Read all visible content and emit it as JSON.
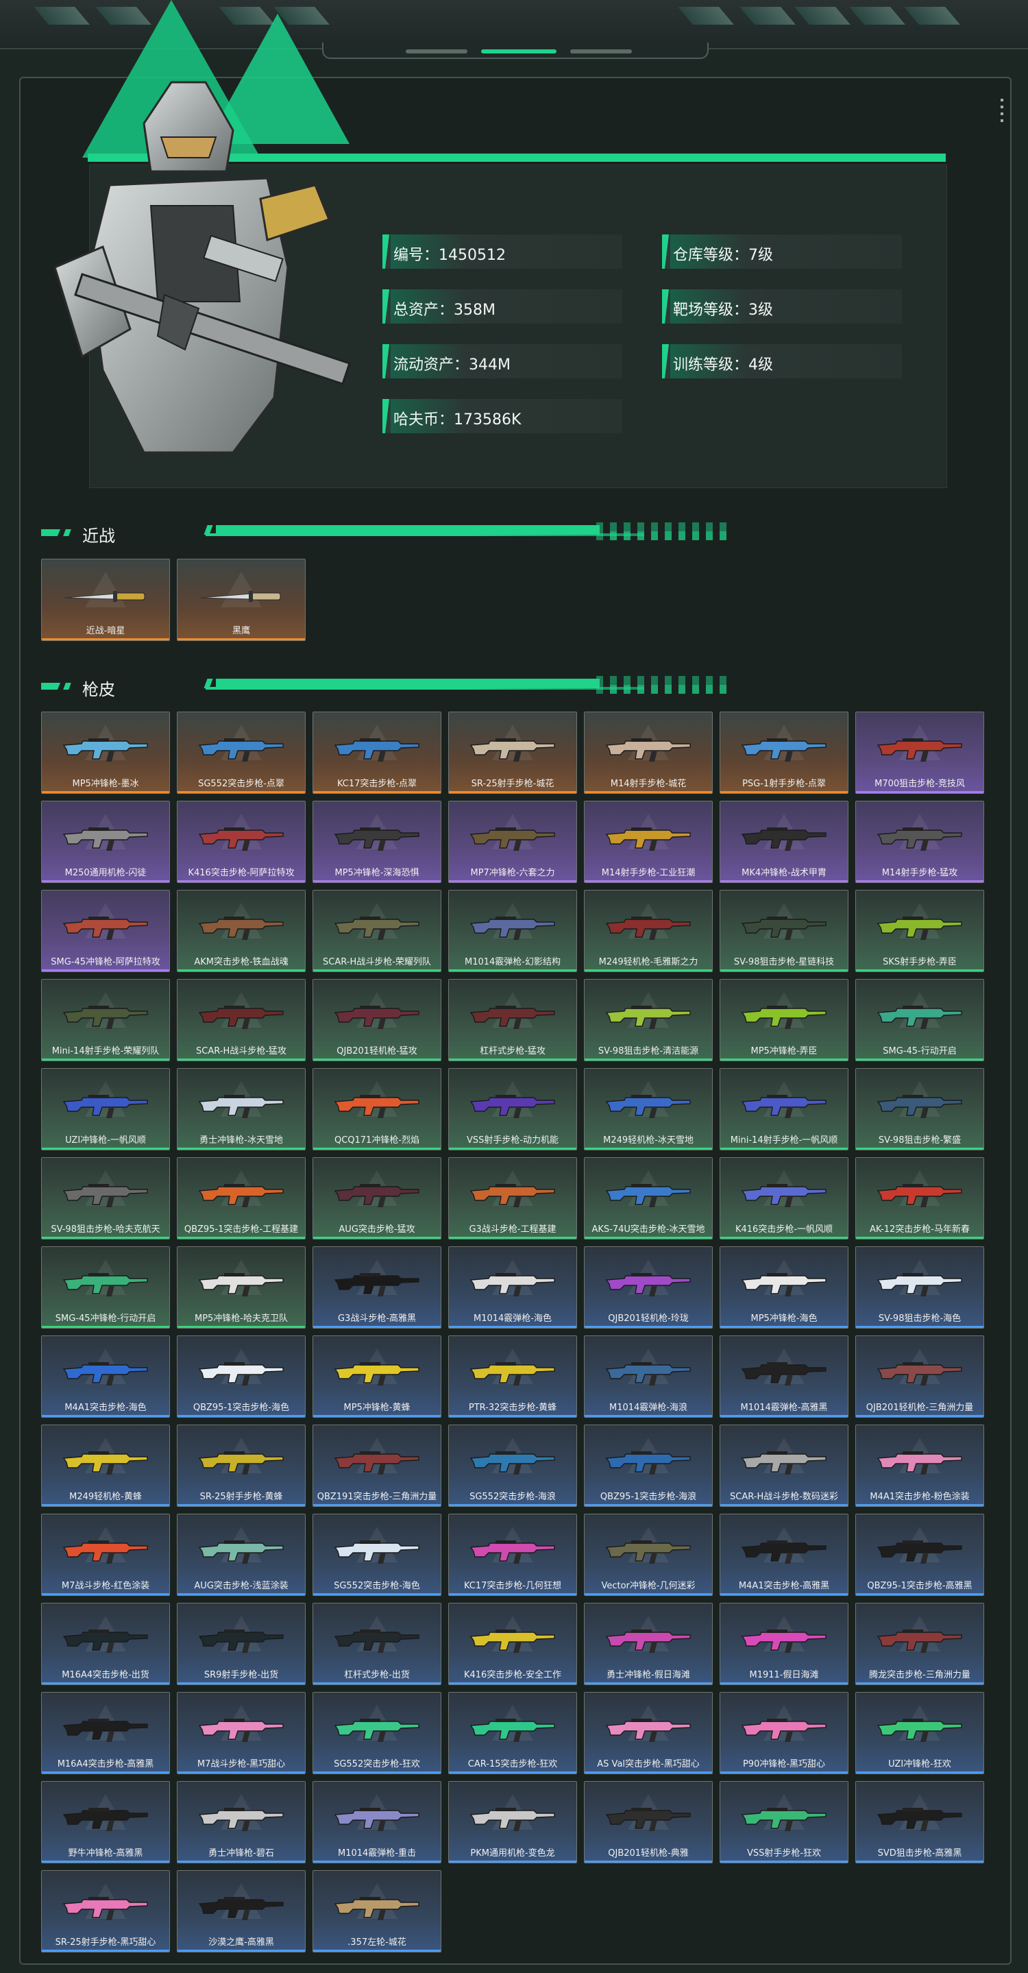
{
  "profile": {
    "stats_left": [
      "编号：1450512",
      "总资产：358M",
      "流动资产：344M",
      "哈夫币：173586K"
    ],
    "stats_right": [
      "仓库等级：7级",
      "靶场等级：3级",
      "训练等级：4级"
    ]
  },
  "sections": {
    "melee_title": "近战",
    "skins_title": "枪皮"
  },
  "melee": [
    {
      "label": "近战-暗星",
      "rarity": "orange",
      "color": "#c9a53a"
    },
    {
      "label": "黑鹰",
      "rarity": "orange",
      "color": "#c8b690"
    }
  ],
  "skins": [
    {
      "label": "MP5冲锋枪-墨冰",
      "rarity": "orange",
      "color": "#5fb0d8"
    },
    {
      "label": "SG552突击步枪-点翠",
      "rarity": "orange",
      "color": "#3f86c9"
    },
    {
      "label": "KC17突击步枪-点翠",
      "rarity": "orange",
      "color": "#3b7fc4"
    },
    {
      "label": "SR-25射手步枪-城花",
      "rarity": "orange",
      "color": "#c8b8a0"
    },
    {
      "label": "M14射手步枪-城花",
      "rarity": "orange",
      "color": "#c9b09a"
    },
    {
      "label": "PSG-1射手步枪-点翠",
      "rarity": "orange",
      "color": "#4a8fd0"
    },
    {
      "label": "M700狙击步枪-竞技风",
      "rarity": "purple",
      "color": "#b03a2e"
    },
    {
      "label": "M250通用机枪-闪徒",
      "rarity": "purple",
      "color": "#8c8c8c"
    },
    {
      "label": "K416突击步枪-阿萨拉特攻",
      "rarity": "purple",
      "color": "#a53a3a"
    },
    {
      "label": "MP5冲锋枪-深海恐惧",
      "rarity": "purple",
      "color": "#3a3a3a"
    },
    {
      "label": "MP7冲锋枪-六套之力",
      "rarity": "purple",
      "color": "#6a5a3a"
    },
    {
      "label": "M14射手步枪-工业狂潮",
      "rarity": "purple",
      "color": "#c9982a"
    },
    {
      "label": "MK4冲锋枪-战术甲胄",
      "rarity": "purple",
      "color": "#2e2e2e"
    },
    {
      "label": "M14射手步枪-猛攻",
      "rarity": "purple",
      "color": "#555555"
    },
    {
      "label": "SMG-45冲锋枪-阿萨拉特攻",
      "rarity": "purple",
      "color": "#b04a3a"
    },
    {
      "label": "AKM突击步枪-铁血战魂",
      "rarity": "green",
      "color": "#8a5a3a"
    },
    {
      "label": "SCAR-H战斗步枪-荣耀列队",
      "rarity": "green",
      "color": "#6b6b4a"
    },
    {
      "label": "M1014霰弹枪-幻影结构",
      "rarity": "green",
      "color": "#5a6aa0"
    },
    {
      "label": "M249轻机枪-毛雅斯之力",
      "rarity": "green",
      "color": "#8a2e2e"
    },
    {
      "label": "SV-98狙击步枪-星链科技",
      "rarity": "green",
      "color": "#3a4a3a"
    },
    {
      "label": "SKS射手步枪-弄臣",
      "rarity": "green",
      "color": "#8ab82a"
    },
    {
      "label": "Mini-14射手步枪-荣耀列队",
      "rarity": "green",
      "color": "#4a5a3a"
    },
    {
      "label": "SCAR-H战斗步枪-猛攻",
      "rarity": "green",
      "color": "#6a2a2a"
    },
    {
      "label": "QJB201轻机枪-猛攻",
      "rarity": "green",
      "color": "#6a2e3a"
    },
    {
      "label": "杠杆式步枪-猛攻",
      "rarity": "green",
      "color": "#6a2e2e"
    },
    {
      "label": "SV-98狙击步枪-清洁能源",
      "rarity": "green",
      "color": "#9ac23a"
    },
    {
      "label": "MP5冲锋枪-弄臣",
      "rarity": "green",
      "color": "#8ac22a"
    },
    {
      "label": "SMG-45-行动开启",
      "rarity": "green",
      "color": "#3aa88a"
    },
    {
      "label": "UZI冲锋枪-一帆风顺",
      "rarity": "green",
      "color": "#3a5ac8"
    },
    {
      "label": "勇士冲锋枪-冰天雪地",
      "rarity": "green",
      "color": "#c8d4e0"
    },
    {
      "label": "QCQ171冲锋枪-烈焰",
      "rarity": "green",
      "color": "#e05a2e"
    },
    {
      "label": "VSS射手步枪-动力机能",
      "rarity": "green",
      "color": "#5a3ab0"
    },
    {
      "label": "M249轻机枪-冰天雪地",
      "rarity": "green",
      "color": "#3a6ac8"
    },
    {
      "label": "Mini-14射手步枪-一帆风顺",
      "rarity": "green",
      "color": "#4a5ac8"
    },
    {
      "label": "SV-98狙击步枪-繁盛",
      "rarity": "green",
      "color": "#3a5a7a"
    },
    {
      "label": "SV-98狙击步枪-哈夫克航天",
      "rarity": "green",
      "color": "#6a6a6a"
    },
    {
      "label": "QBZ95-1突击步枪-工程基建",
      "rarity": "green",
      "color": "#d8642a"
    },
    {
      "label": "AUG突击步枪-猛攻",
      "rarity": "green",
      "color": "#5a2e3a"
    },
    {
      "label": "G3战斗步枪-工程基建",
      "rarity": "green",
      "color": "#c8642e"
    },
    {
      "label": "AKS-74U突击步枪-冰天雪地",
      "rarity": "green",
      "color": "#3a7ac8"
    },
    {
      "label": "K416突击步枪-一帆风顺",
      "rarity": "green",
      "color": "#5a6ad0"
    },
    {
      "label": "AK-12突击步枪-马年新春",
      "rarity": "green",
      "color": "#c83a2e"
    },
    {
      "label": "SMG-45冲锋枪-行动开启",
      "rarity": "green",
      "color": "#3ab07a"
    },
    {
      "label": "MP5冲锋枪-哈夫克卫队",
      "rarity": "green",
      "color": "#e0e0e0"
    },
    {
      "label": "G3战斗步枪-高雅黑",
      "rarity": "blue",
      "color": "#1a1a1a"
    },
    {
      "label": "M1014霰弹枪-海色",
      "rarity": "blue",
      "color": "#dcdcdc"
    },
    {
      "label": "QJB201轻机枪-玲珑",
      "rarity": "blue",
      "color": "#a04ac8"
    },
    {
      "label": "MP5冲锋枪-海色",
      "rarity": "blue",
      "color": "#e8e8e8"
    },
    {
      "label": "SV-98狙击步枪-海色",
      "rarity": "blue",
      "color": "#dfe8f0"
    },
    {
      "label": "M4A1突击步枪-海色",
      "rarity": "blue",
      "color": "#2e6ad0"
    },
    {
      "label": "QBZ95-1突击步枪-海色",
      "rarity": "blue",
      "color": "#e8eef4"
    },
    {
      "label": "MP5冲锋枪-黄蜂",
      "rarity": "blue",
      "color": "#e0c82a"
    },
    {
      "label": "PTR-32突击步枪-黄蜂",
      "rarity": "blue",
      "color": "#d8c02a"
    },
    {
      "label": "M1014霰弹枪-海浪",
      "rarity": "blue",
      "color": "#3a6a9a"
    },
    {
      "label": "M1014霰弹枪-高雅黑",
      "rarity": "blue",
      "color": "#222222"
    },
    {
      "label": "QJB201轻机枪-三角洲力量",
      "rarity": "blue",
      "color": "#8a4a4a"
    },
    {
      "label": "M249轻机枪-黄蜂",
      "rarity": "blue",
      "color": "#d8c02a"
    },
    {
      "label": "SR-25射手步枪-黄蜂",
      "rarity": "blue",
      "color": "#c8b02a"
    },
    {
      "label": "QBZ191突击步枪-三角洲力量",
      "rarity": "blue",
      "color": "#8a3a3a"
    },
    {
      "label": "SG552突击步枪-海浪",
      "rarity": "blue",
      "color": "#2e7ab0"
    },
    {
      "label": "QBZ95-1突击步枪-海浪",
      "rarity": "blue",
      "color": "#2e6ab0"
    },
    {
      "label": "SCAR-H战斗步枪-数码迷彩",
      "rarity": "blue",
      "color": "#a8a8a8"
    },
    {
      "label": "M4A1突击步枪-粉色涂装",
      "rarity": "blue",
      "color": "#e088b8"
    },
    {
      "label": "M7战斗步枪-红色涂装",
      "rarity": "blue",
      "color": "#e0502e"
    },
    {
      "label": "AUG突击步枪-浅蓝涂装",
      "rarity": "blue",
      "color": "#7ab8a8"
    },
    {
      "label": "SG552突击步枪-海色",
      "rarity": "blue",
      "color": "#d8e4f0"
    },
    {
      "label": "KC17突击步枪-几何狂想",
      "rarity": "blue",
      "color": "#d04ab0"
    },
    {
      "label": "Vector冲锋枪-几何迷彩",
      "rarity": "blue",
      "color": "#6a6a4a"
    },
    {
      "label": "M4A1突击步枪-高雅黑",
      "rarity": "blue",
      "color": "#1e1e1e"
    },
    {
      "label": "QBZ95-1突击步枪-高雅黑",
      "rarity": "blue",
      "color": "#1e1e1e"
    },
    {
      "label": "M16A4突击步枪-出货",
      "rarity": "blue",
      "color": "#1e2a2e"
    },
    {
      "label": "SR9射手步枪-出货",
      "rarity": "blue",
      "color": "#1e2a2e"
    },
    {
      "label": "杠杆式步枪-出货",
      "rarity": "blue",
      "color": "#222a2e"
    },
    {
      "label": "K416突击步枪-安全工作",
      "rarity": "blue",
      "color": "#d8c02a"
    },
    {
      "label": "勇士冲锋枪-假日海滩",
      "rarity": "blue",
      "color": "#c84ab0"
    },
    {
      "label": "M1911-假日海滩",
      "rarity": "blue",
      "color": "#d84ab8"
    },
    {
      "label": "腾龙突击步枪-三角洲力量",
      "rarity": "blue",
      "color": "#8a3a3a"
    },
    {
      "label": "M16A4突击步枪-高雅黑",
      "rarity": "blue",
      "color": "#1e1e1e"
    },
    {
      "label": "M7战斗步枪-黑巧甜心",
      "rarity": "blue",
      "color": "#e88ac0"
    },
    {
      "label": "SG552突击步枪-狂欢",
      "rarity": "blue",
      "color": "#3ac88a"
    },
    {
      "label": "CAR-15突击步枪-狂欢",
      "rarity": "blue",
      "color": "#2ec88a"
    },
    {
      "label": "AS Val突击步枪-黑巧甜心",
      "rarity": "blue",
      "color": "#e88ac0"
    },
    {
      "label": "P90冲锋枪-黑巧甜心",
      "rarity": "blue",
      "color": "#e878b8"
    },
    {
      "label": "UZI冲锋枪-狂欢",
      "rarity": "blue",
      "color": "#3ac878"
    },
    {
      "label": "野牛冲锋枪-高雅黑",
      "rarity": "blue",
      "color": "#1e1e1e"
    },
    {
      "label": "勇士冲锋枪-碧石",
      "rarity": "blue",
      "color": "#c8c8c8"
    },
    {
      "label": "M1014霰弹枪-重击",
      "rarity": "blue",
      "color": "#8a8ac8"
    },
    {
      "label": "PKM通用机枪-变色龙",
      "rarity": "blue",
      "color": "#c8c8c8"
    },
    {
      "label": "QJB201轻机枪-典雅",
      "rarity": "blue",
      "color": "#2e2e2e"
    },
    {
      "label": "VSS射手步枪-狂欢",
      "rarity": "blue",
      "color": "#3ab878"
    },
    {
      "label": "SVD狙击步枪-高雅黑",
      "rarity": "blue",
      "color": "#1e1e1e"
    },
    {
      "label": "SR-25射手步枪-黑巧甜心",
      "rarity": "blue",
      "color": "#e878b8"
    },
    {
      "label": "沙漠之鹰-高雅黑",
      "rarity": "blue",
      "color": "#1e1e1e"
    },
    {
      "label": ".357左轮-城花",
      "rarity": "blue",
      "color": "#b89a6a"
    }
  ]
}
